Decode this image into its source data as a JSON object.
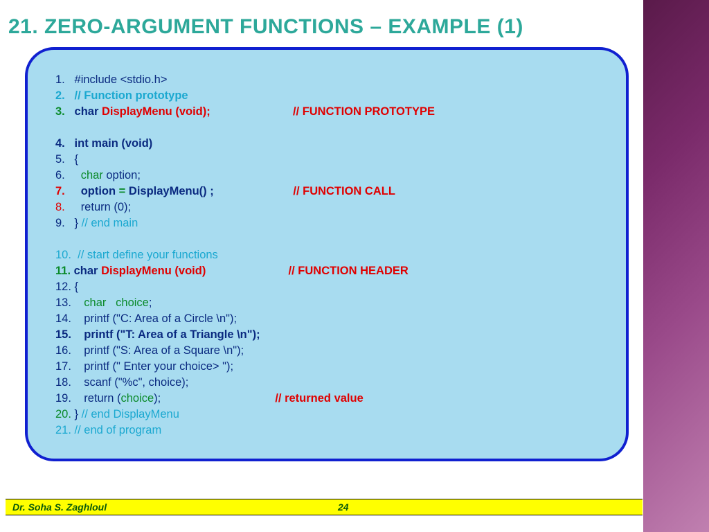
{
  "title": "21. ZERO-ARGUMENT FUNCTIONS  – EXAMPLE (1)",
  "footer": {
    "author": "Dr. Soha S. Zaghloul",
    "page": "24"
  },
  "lines": {
    "l1": {
      "num": "1.",
      "text": "#include <stdio.h>"
    },
    "l2": {
      "num": "2.",
      "text": "// Function prototype"
    },
    "l3": {
      "num": "3.",
      "kw": "char",
      "fn": " DisplayMenu (void);",
      "comment": "// FUNCTION PROTOTYPE"
    },
    "l4": {
      "num": "4.",
      "text": "int main (void)"
    },
    "l5": {
      "num": "5.",
      "text": "{"
    },
    "l6": {
      "num": "6.",
      "kw": "char",
      "var": " option",
      "semi": ";"
    },
    "l7": {
      "num": "7.",
      "var": "option",
      "eq": " = ",
      "fn": "DisplayMenu() ;",
      "comment": "// FUNCTION CALL"
    },
    "l8": {
      "num": "8.",
      "text": "return (0);"
    },
    "l9": {
      "num": "9.",
      "brace": "}",
      "comment": " // end main"
    },
    "l10": {
      "num": "10.",
      "text": "// start define your functions"
    },
    "l11": {
      "num": "11.",
      "kw": "char",
      "fn": " DisplayMenu (void)",
      "comment": "// FUNCTION HEADER"
    },
    "l12": {
      "num": "12.",
      "text": "{"
    },
    "l13": {
      "num": "13.",
      "kw": "char",
      "var": "   choice",
      "semi": ";"
    },
    "l14": {
      "num": "14.",
      "text": "printf (\"C: Area of a Circle \\n\");"
    },
    "l15": {
      "num": "15.",
      "text": "printf (\"T: Area of a Triangle \\n\");"
    },
    "l16": {
      "num": "16.",
      "text": "printf (\"S: Area of a Square \\n\");"
    },
    "l17": {
      "num": "17.",
      "text": "printf (\" Enter your choice> \");"
    },
    "l18": {
      "num": "18.",
      "text": "scanf (\"%c\", choice);"
    },
    "l19": {
      "num": "19.",
      "pre": "return (",
      "var": "choice",
      "post": ");",
      "comment": "// returned value"
    },
    "l20": {
      "num": "20.",
      "brace": "}",
      "comment": " // end DisplayMenu"
    },
    "l21": {
      "num": "21.",
      "text": "// end of program"
    }
  }
}
